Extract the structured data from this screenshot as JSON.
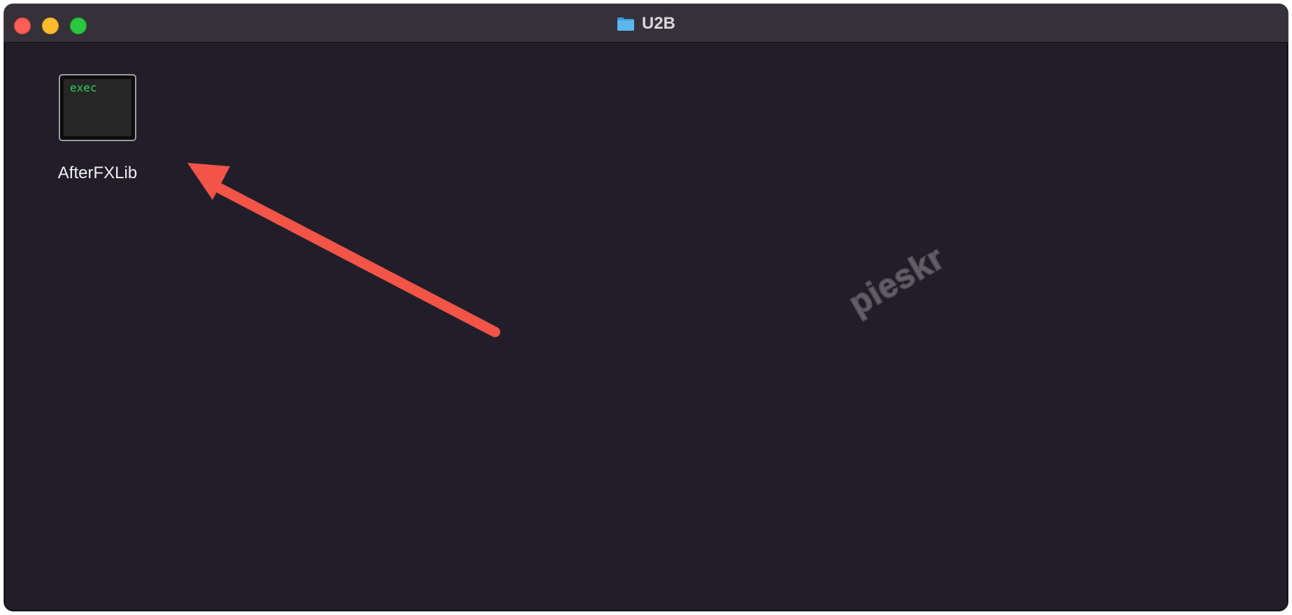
{
  "window": {
    "title": "U2B"
  },
  "files": [
    {
      "name": "AfterFXLib",
      "icon_label": "exec",
      "icon": "exec-icon"
    }
  ],
  "watermark": "pieskr",
  "colors": {
    "window_bg": "#221e29",
    "titlebar_bg": "#363139",
    "close": "#ff5f57",
    "minimize": "#febc2e",
    "maximize": "#28c840",
    "arrow": "#f25448",
    "exec_text": "#2ed05a"
  }
}
